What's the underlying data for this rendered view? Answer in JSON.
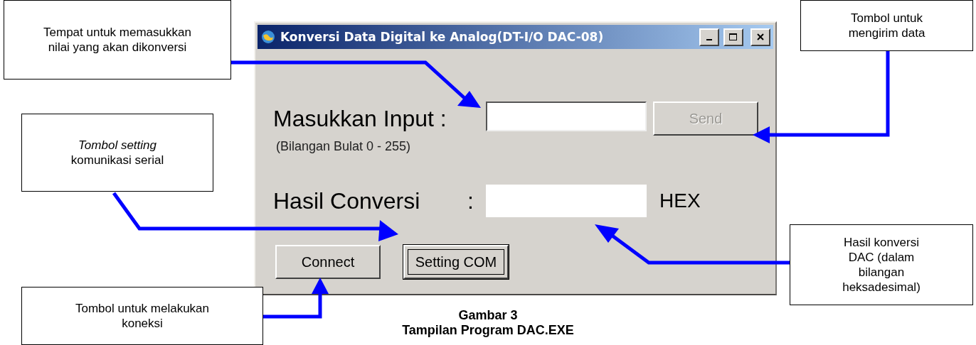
{
  "callouts": [
    {
      "text": "Tempat untuk memasukkan nilai yang akan dikonversi"
    },
    {
      "text": "Tombol untuk mengirim data"
    },
    {
      "text": "*Tombol setting* komunikasi serial"
    },
    {
      "text": "Hasil konversi DAC (dalam bilangan heksadesimal)"
    },
    {
      "text": "Tombol untuk melakukan koneksi"
    }
  ],
  "window": {
    "title": "Konversi Data Digital ke Analog(DT-I/O DAC-08)",
    "input_row": {
      "label": "Masukkan Input :",
      "hint": "(Bilangan Bulat 0 - 255)",
      "button": {
        "label": "Send",
        "disabled": true,
        "focused": false
      }
    },
    "result_row": {
      "label": "Hasil Conversi",
      "colon": ":",
      "unit": "HEX"
    },
    "buttons": [
      {
        "label": "Connect",
        "disabled": false,
        "focused": false
      },
      {
        "label": "Setting COM",
        "disabled": false,
        "focused": true
      }
    ]
  },
  "caption": {
    "number": "Gambar 3",
    "title": "Tampilan Program DAC.EXE"
  }
}
